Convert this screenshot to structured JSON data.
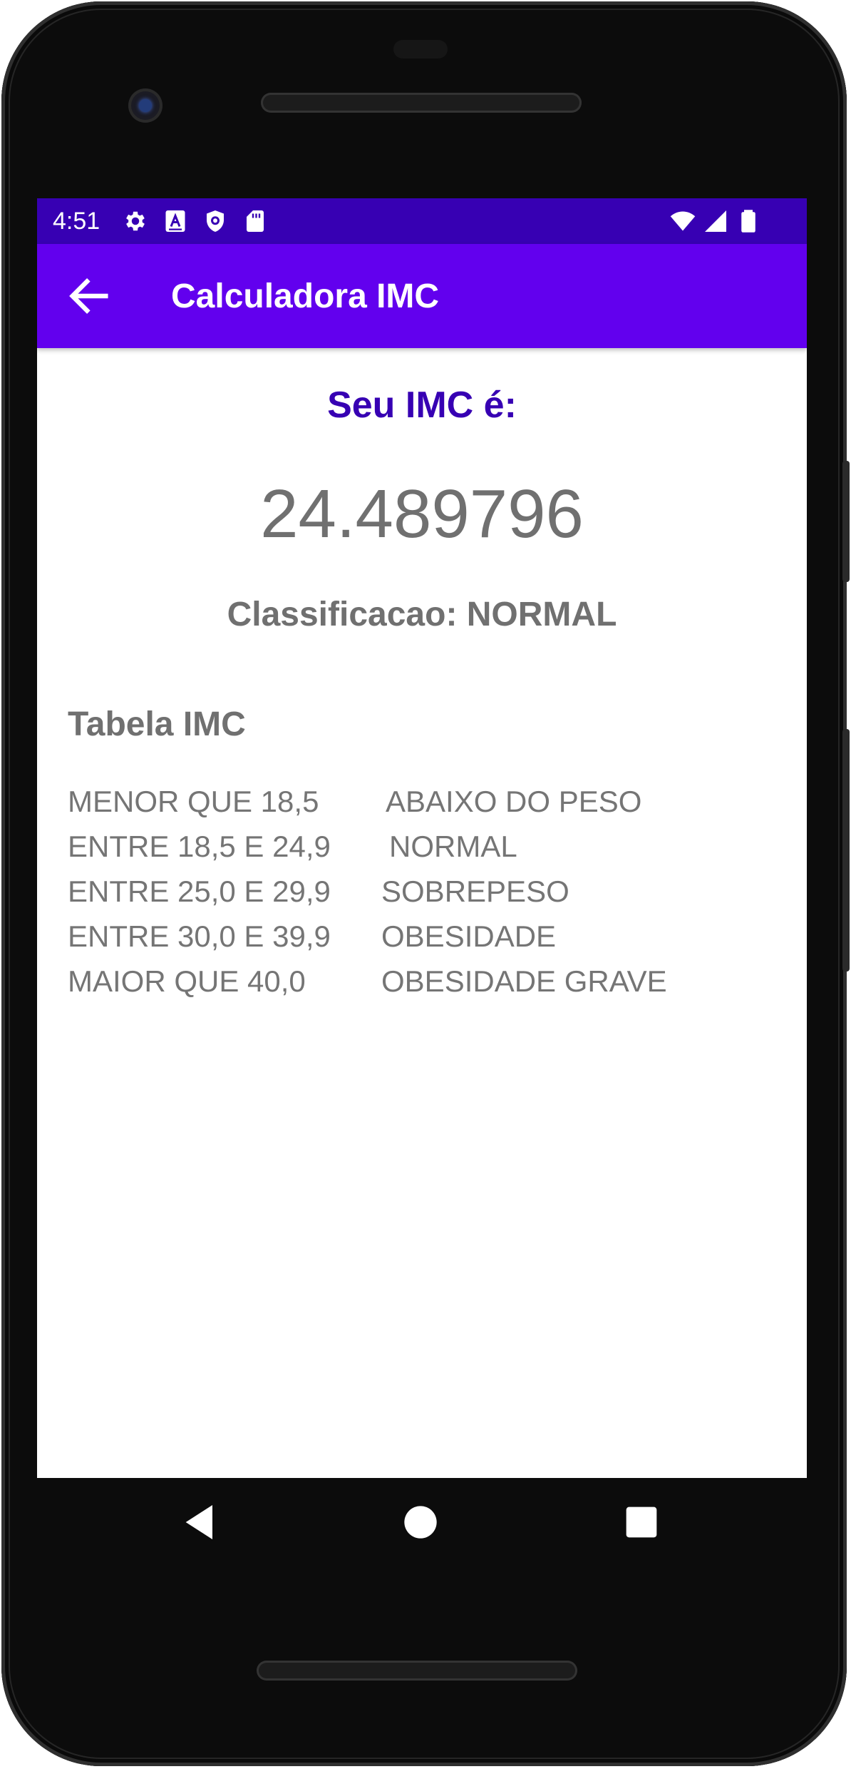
{
  "status_bar": {
    "time": "4:51",
    "left_icons": [
      "gear-icon",
      "a-text-icon",
      "shield-icon",
      "sd-card-icon"
    ],
    "right_icons": [
      "wifi-icon",
      "signal-icon",
      "battery-icon"
    ],
    "background": "#3700b3"
  },
  "app_bar": {
    "title": "Calculadora IMC",
    "background": "#6200ee",
    "back_icon": "arrow-back-icon"
  },
  "result": {
    "heading": "Seu IMC é:",
    "value": "24.489796",
    "classification": "Classificacao: NORMAL",
    "heading_color": "#3700b3"
  },
  "table": {
    "heading": "Tabela IMC",
    "rows": [
      {
        "range": "MENOR QUE 18,5",
        "class": "ABAIXO DO PESO"
      },
      {
        "range": "ENTRE 18,5 E 24,9",
        "class": "NORMAL"
      },
      {
        "range": "ENTRE 25,0 E 29,9",
        "class": "SOBREPESO"
      },
      {
        "range": "ENTRE 30,0 E 39,9",
        "class": "OBESIDADE"
      },
      {
        "range": "MAIOR QUE 40,0",
        "class": "OBESIDADE GRAVE"
      }
    ]
  },
  "nav_bar": {
    "icons": [
      "back-triangle-icon",
      "home-circle-icon",
      "recents-square-icon"
    ]
  }
}
